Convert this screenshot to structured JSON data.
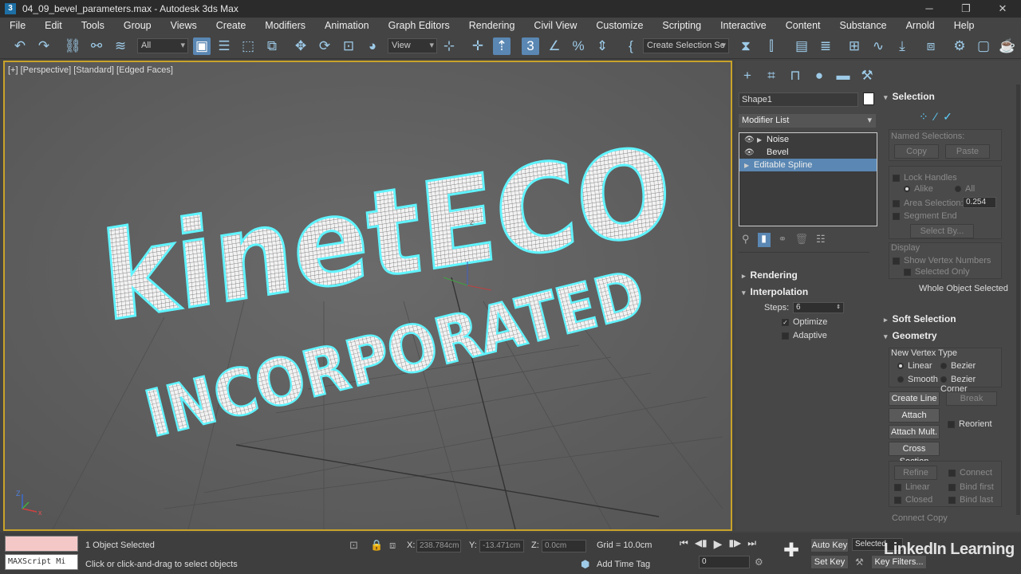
{
  "window": {
    "title": "04_09_bevel_parameters.max - Autodesk 3ds Max",
    "app_icon": "3",
    "minimize": "─",
    "restore": "❐",
    "close": "✕"
  },
  "menu": [
    "File",
    "Edit",
    "Tools",
    "Group",
    "Views",
    "Create",
    "Modifiers",
    "Animation",
    "Graph Editors",
    "Rendering",
    "Civil View",
    "Customize",
    "Scripting",
    "Interactive",
    "Content",
    "Substance",
    "Arnold",
    "Help"
  ],
  "toolbar": {
    "filter": "All",
    "ref_coord": "View",
    "selection_set": "Create Selection Se"
  },
  "viewport": {
    "label": "[+] [Perspective] [Standard] [Edged Faces]",
    "text_main": "kinetECO",
    "text_sub": "INCORPORATED",
    "gizmo_z": "z",
    "axis_z": "Z",
    "axis_x": "x"
  },
  "command_panel": {
    "object_name": "Shape1",
    "object_color": "#ffffff",
    "modifier_list_label": "Modifier List",
    "stack": [
      {
        "name": "Noise",
        "eye": true,
        "arrow": true,
        "selected": false
      },
      {
        "name": "Bevel",
        "eye": true,
        "arrow": false,
        "selected": false
      },
      {
        "name": "Editable Spline",
        "eye": false,
        "arrow": true,
        "selected": true
      }
    ],
    "rollouts": {
      "rendering": "Rendering",
      "interpolation": "Interpolation",
      "steps_label": "Steps:",
      "steps_value": "6",
      "optimize": "Optimize",
      "optimize_checked": true,
      "adaptive": "Adaptive",
      "adaptive_checked": false
    },
    "selection": {
      "title": "Selection",
      "named_selections": "Named Selections:",
      "copy": "Copy",
      "paste": "Paste",
      "lock_handles": "Lock Handles",
      "alike": "Alike",
      "all": "All",
      "area_selection": "Area Selection:",
      "area_value": "0.254",
      "segment_end": "Segment End",
      "select_by": "Select By...",
      "display": "Display",
      "show_vertex_numbers": "Show Vertex Numbers",
      "selected_only": "Selected Only",
      "status": "Whole Object Selected"
    },
    "soft_selection": "Soft Selection",
    "geometry": {
      "title": "Geometry",
      "new_vertex_type": "New Vertex Type",
      "linear": "Linear",
      "bezier": "Bezier",
      "smooth": "Smooth",
      "bezier_corner": "Bezier Corner",
      "create_line": "Create Line",
      "break": "Break",
      "attach": "Attach",
      "reorient": "Reorient",
      "attach_mult": "Attach Mult.",
      "cross_section": "Cross Section",
      "refine": "Refine",
      "connect": "Connect",
      "linear2": "Linear",
      "bind_first": "Bind first",
      "closed": "Closed",
      "bind_last": "Bind last",
      "connect_copy": "Connect Copy"
    }
  },
  "status": {
    "maxscript": "MAXScript Mi",
    "objects_selected": "1 Object Selected",
    "prompt": "Click or click-and-drag to select objects",
    "x_label": "X:",
    "x_value": "238.784cm",
    "y_label": "Y:",
    "y_value": "-13.471cm",
    "z_label": "Z:",
    "z_value": "0.0cm",
    "grid": "Grid = 10.0cm",
    "add_time_tag": "Add Time Tag",
    "auto_key": "Auto Key",
    "set_key": "Set Key",
    "selected": "Selected",
    "key_filters": "Key Filters...",
    "frame": "0",
    "watermark": "LinkedIn Learning"
  }
}
